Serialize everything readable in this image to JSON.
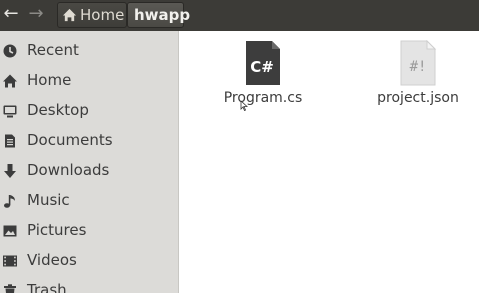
{
  "header": {
    "back_icon": "arrow-left-icon",
    "forward_icon": "arrow-right-icon",
    "breadcrumb": [
      {
        "label": "Home",
        "icon": "home-icon"
      },
      {
        "label": "hwapp"
      }
    ]
  },
  "sidebar": {
    "items": [
      {
        "label": "Recent",
        "icon": "clock-icon"
      },
      {
        "label": "Home",
        "icon": "home-icon"
      },
      {
        "label": "Desktop",
        "icon": "desktop-icon"
      },
      {
        "label": "Documents",
        "icon": "document-icon"
      },
      {
        "label": "Downloads",
        "icon": "download-icon"
      },
      {
        "label": "Music",
        "icon": "music-icon"
      },
      {
        "label": "Pictures",
        "icon": "picture-icon"
      },
      {
        "label": "Videos",
        "icon": "video-icon"
      },
      {
        "label": "Trash",
        "icon": "trash-icon"
      }
    ]
  },
  "files": [
    {
      "name": "Program.cs",
      "badge": "C#",
      "icon": "csharp-file-icon"
    },
    {
      "name": "project.json",
      "badge": "#!",
      "icon": "script-file-icon"
    }
  ],
  "colors": {
    "header_bg": "#3c3b37",
    "sidebar_bg": "#dcdbd8",
    "csharp_icon": "#3d3d3d",
    "json_icon": "#e6e6e6"
  }
}
